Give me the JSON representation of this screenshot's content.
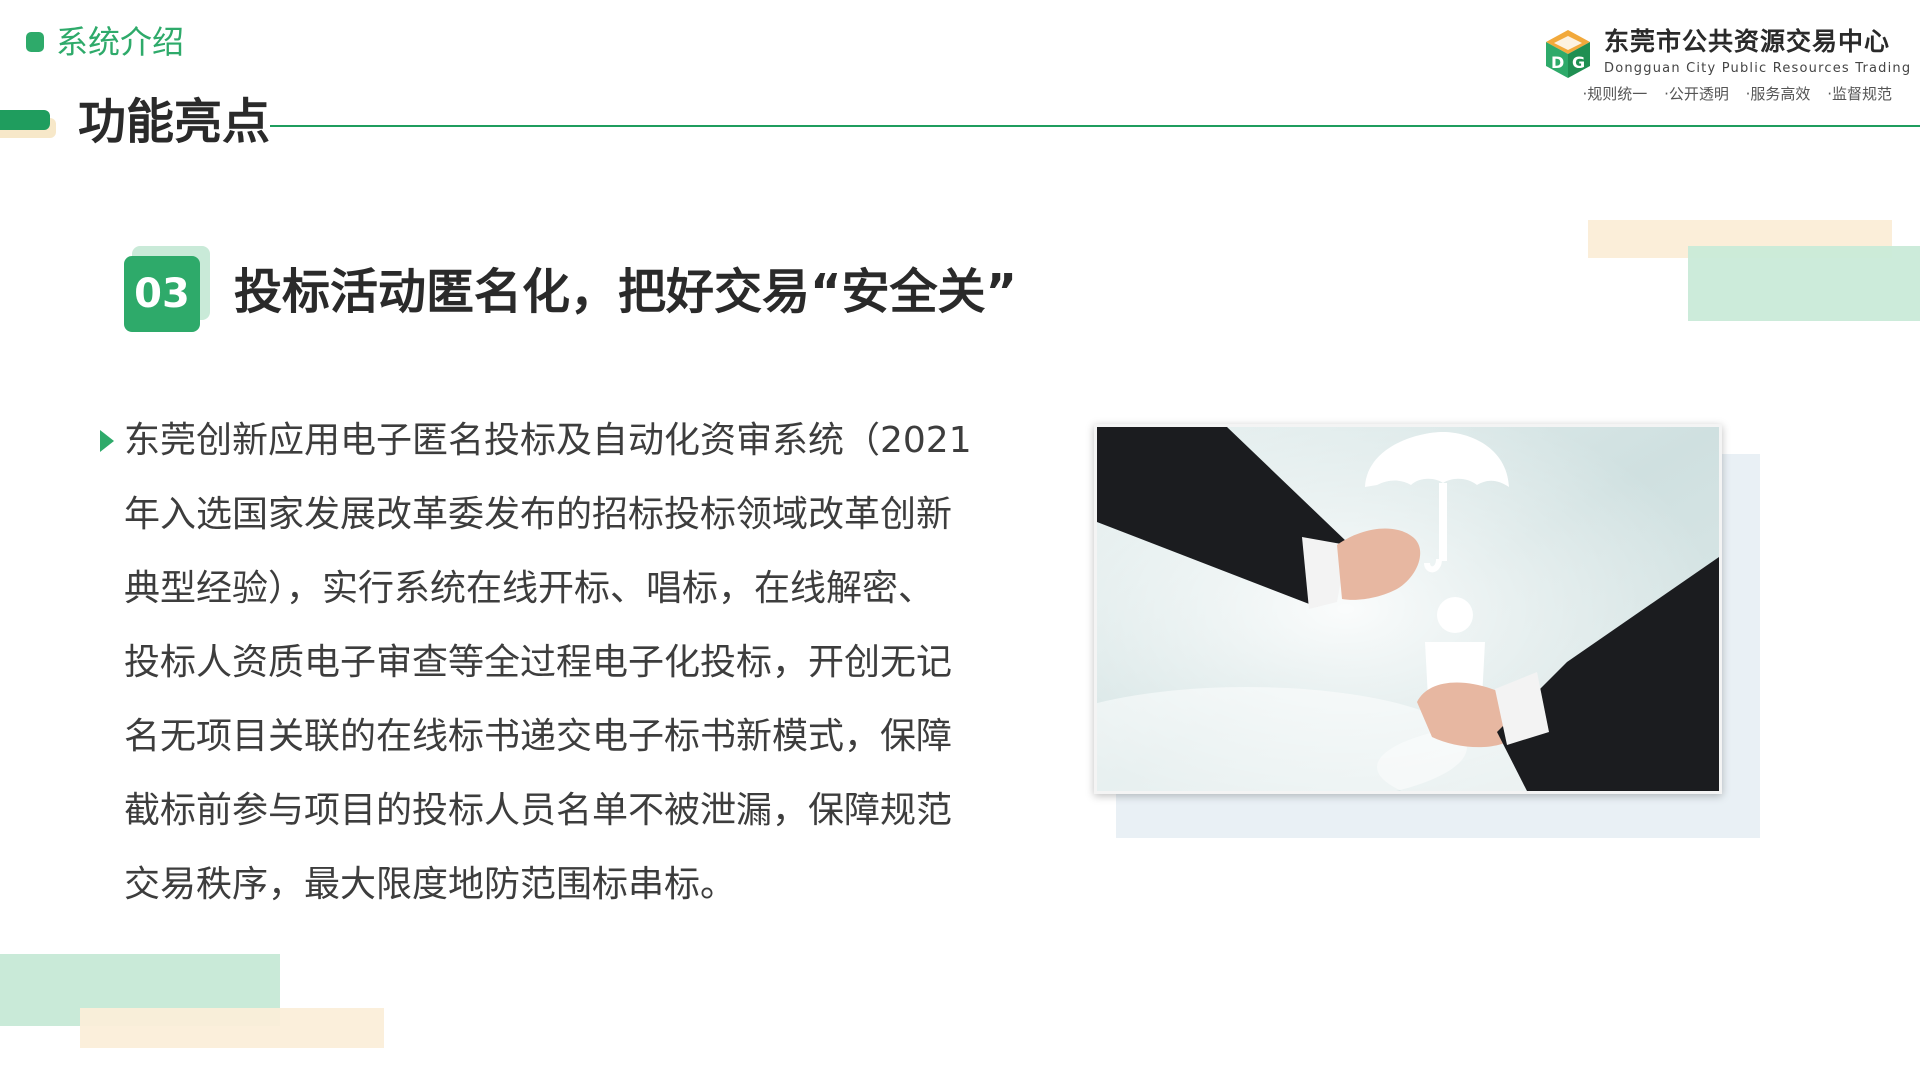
{
  "breadcrumb": {
    "label": "系统介绍"
  },
  "page": {
    "title": "功能亮点"
  },
  "logo": {
    "name_cn": "东莞市公共资源交易中心",
    "name_en": "Dongguan City Public Resources Trading",
    "slogans": [
      "·规则统一",
      "·公开透明",
      "·服务高效",
      "·监督规范"
    ]
  },
  "section": {
    "number": "03",
    "title": "投标活动匿名化，把好交易“安全关”"
  },
  "body": {
    "lines": [
      "东莞创新应用电子匿名投标及自动化资审系统（2021",
      "年入选国家发展改革委发布的招标投标领域改革创新",
      "典型经验），实行系统在线开标、唱标，在线解密、",
      "投标人资质电子审查等全过程电子化投标，开创无记",
      "名无项目关联的在线标书递交电子标书新模式，保障",
      "截标前参与项目的投标人员名单不被泄漏，保障规范",
      "交易秩序，最大限度地防范围标串标。"
    ]
  },
  "colors": {
    "accent_green": "#2eaa6a",
    "dark_green": "#1f9d5e",
    "light_green": "#c9ead8",
    "light_beige": "#fbeed9"
  },
  "icons": {
    "photo": "handover-umbrella-person-photo",
    "logo": "cube-logo-icon"
  }
}
